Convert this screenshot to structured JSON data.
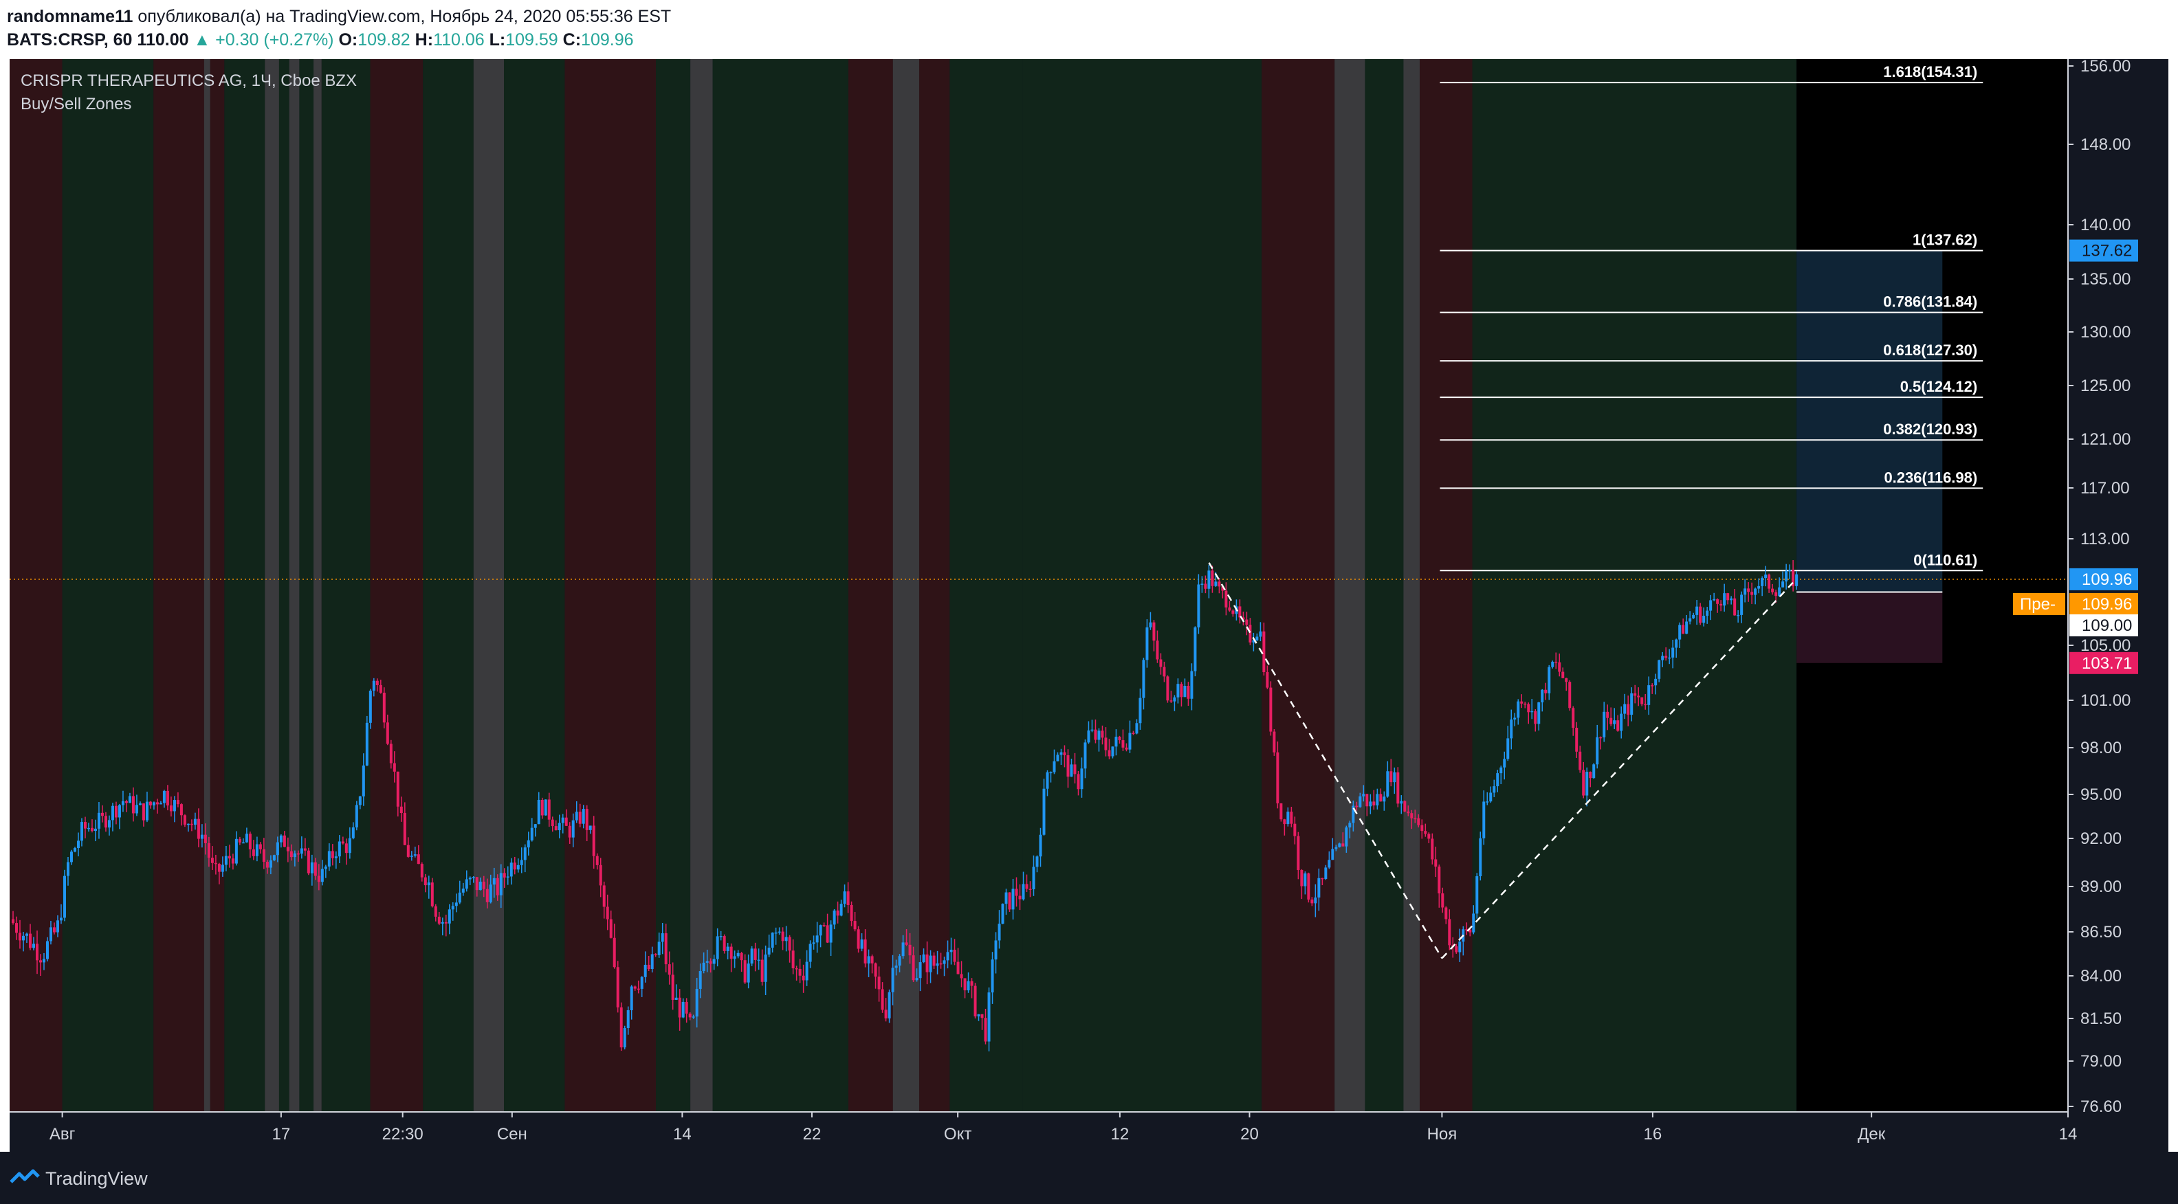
{
  "header": {
    "author": "randomname11",
    "published_text": "опубликовал(а) на TradingView.com, Ноябрь 24, 2020 05:55:36 EST",
    "symbol": "BATS:CRSP, 60",
    "last": "110.00",
    "change": "+0.30 (+0.27%)",
    "o_label": "O:",
    "o_value": "109.82",
    "h_label": "H:",
    "h_value": "110.06",
    "l_label": "L:",
    "l_value": "109.59",
    "c_label": "C:",
    "c_value": "109.96"
  },
  "legend": {
    "title": "CRISPR THERAPEUTICS AG, 1Ч, Cboe BZX",
    "indicator": "Buy/Sell Zones"
  },
  "footer": {
    "brand": "TradingView"
  },
  "colors": {
    "background": "#131722",
    "up": "#2196f3",
    "down": "#e91e63",
    "zone_buy": "#11251a",
    "zone_sell": "#2f1317",
    "zone_neutral": "#3a3a3d",
    "axis_text": "#d1d4dc",
    "price_line": "#ff9800"
  },
  "chart_data": {
    "type": "candlestick",
    "title": "CRISPR THERAPEUTICS AG, 1Ч, Cboe BZX",
    "xlabel": "",
    "ylabel": "",
    "ylim": [
      76.6,
      156.0
    ],
    "y_ticks": [
      "156.00",
      "148.00",
      "140.00",
      "135.00",
      "130.00",
      "125.00",
      "121.00",
      "117.00",
      "113.00",
      "105.00",
      "101.00",
      "98.00",
      "95.00",
      "92.00",
      "89.00",
      "86.50",
      "84.00",
      "81.50",
      "79.00",
      "76.60"
    ],
    "x_ticks": [
      {
        "label": "Авг",
        "pos": 0.0
      },
      {
        "label": "17",
        "pos": 10.8
      },
      {
        "label": "22:30",
        "pos": 16.8
      },
      {
        "label": "Сен",
        "pos": 22.2
      },
      {
        "label": "14",
        "pos": 30.6
      },
      {
        "label": "22",
        "pos": 37.0
      },
      {
        "label": "Окт",
        "pos": 44.2
      },
      {
        "label": "12",
        "pos": 52.2
      },
      {
        "label": "20",
        "pos": 58.6
      },
      {
        "label": "Ноя",
        "pos": 68.1
      },
      {
        "label": "16",
        "pos": 78.5
      },
      {
        "label": "Дек",
        "pos": 89.3
      },
      {
        "label": "14",
        "pos": 99.0
      }
    ],
    "x_range": [
      -2.6,
      99.0
    ],
    "price_path": [
      [
        -2.6,
        87.2
      ],
      [
        -2.0,
        86.5
      ],
      [
        -1.0,
        85.2
      ],
      [
        -0.2,
        86.8
      ],
      [
        0.3,
        90.5
      ],
      [
        1.0,
        92.6
      ],
      [
        2.0,
        93.2
      ],
      [
        3.0,
        94.6
      ],
      [
        4.0,
        93.8
      ],
      [
        5.0,
        95.1
      ],
      [
        6.0,
        93.6
      ],
      [
        7.0,
        92.1
      ],
      [
        7.5,
        89.6
      ],
      [
        8.3,
        90.9
      ],
      [
        9.0,
        91.8
      ],
      [
        10.0,
        90.6
      ],
      [
        11.0,
        91.9
      ],
      [
        12.0,
        90.6
      ],
      [
        12.8,
        89.6
      ],
      [
        13.5,
        91.4
      ],
      [
        14.3,
        91.7
      ],
      [
        14.8,
        96.1
      ],
      [
        15.3,
        103.0
      ],
      [
        15.8,
        101.0
      ],
      [
        16.4,
        96.2
      ],
      [
        16.9,
        91.5
      ],
      [
        17.4,
        90.4
      ],
      [
        18.0,
        89.6
      ],
      [
        18.4,
        87.9
      ],
      [
        18.9,
        86.9
      ],
      [
        19.5,
        88.6
      ],
      [
        20.2,
        89.3
      ],
      [
        20.9,
        88.8
      ],
      [
        21.5,
        88.9
      ],
      [
        22.0,
        90.1
      ],
      [
        22.5,
        90.9
      ],
      [
        23.0,
        92.2
      ],
      [
        23.6,
        94.4
      ],
      [
        24.3,
        93.2
      ],
      [
        25.0,
        92.5
      ],
      [
        25.7,
        93.7
      ],
      [
        26.1,
        92.1
      ],
      [
        26.6,
        88.6
      ],
      [
        27.1,
        85.8
      ],
      [
        27.6,
        80.2
      ],
      [
        28.1,
        83.6
      ],
      [
        28.6,
        83.9
      ],
      [
        29.1,
        84.6
      ],
      [
        29.6,
        86.2
      ],
      [
        30.1,
        82.8
      ],
      [
        30.6,
        81.9
      ],
      [
        31.1,
        80.7
      ],
      [
        31.6,
        85.3
      ],
      [
        32.1,
        85.4
      ],
      [
        32.6,
        86.0
      ],
      [
        33.1,
        85.6
      ],
      [
        33.6,
        84.0
      ],
      [
        34.1,
        85.1
      ],
      [
        34.6,
        84.1
      ],
      [
        35.1,
        86.3
      ],
      [
        35.6,
        86.5
      ],
      [
        36.1,
        84.3
      ],
      [
        36.6,
        84.3
      ],
      [
        37.1,
        86.4
      ],
      [
        37.6,
        86.2
      ],
      [
        38.1,
        87.3
      ],
      [
        38.6,
        88.4
      ],
      [
        39.1,
        87.1
      ],
      [
        39.6,
        84.8
      ],
      [
        40.1,
        83.9
      ],
      [
        40.6,
        81.7
      ],
      [
        41.1,
        85.2
      ],
      [
        41.6,
        85.8
      ],
      [
        42.1,
        84.1
      ],
      [
        42.6,
        84.8
      ],
      [
        43.1,
        84.6
      ],
      [
        43.6,
        85.7
      ],
      [
        44.1,
        84.2
      ],
      [
        44.6,
        83.7
      ],
      [
        45.1,
        82.1
      ],
      [
        45.6,
        80.7
      ],
      [
        46.1,
        86.6
      ],
      [
        46.6,
        88.1
      ],
      [
        47.1,
        88.7
      ],
      [
        47.6,
        88.5
      ],
      [
        48.1,
        90.9
      ],
      [
        48.6,
        96.4
      ],
      [
        49.1,
        97.9
      ],
      [
        49.6,
        96.8
      ],
      [
        50.1,
        95.5
      ],
      [
        50.6,
        98.9
      ],
      [
        51.1,
        98.6
      ],
      [
        51.6,
        97.9
      ],
      [
        52.1,
        98.3
      ],
      [
        52.6,
        98.6
      ],
      [
        53.1,
        100.2
      ],
      [
        53.6,
        107.0
      ],
      [
        54.1,
        103.7
      ],
      [
        54.6,
        101.4
      ],
      [
        55.1,
        102.0
      ],
      [
        55.6,
        101.1
      ],
      [
        56.1,
        109.4
      ],
      [
        56.6,
        110.2
      ],
      [
        57.1,
        109.0
      ],
      [
        57.6,
        108.3
      ],
      [
        58.1,
        106.8
      ],
      [
        58.6,
        105.6
      ],
      [
        59.1,
        106.4
      ],
      [
        59.6,
        100.0
      ],
      [
        60.1,
        93.4
      ],
      [
        60.6,
        93.9
      ],
      [
        61.1,
        89.8
      ],
      [
        61.6,
        88.5
      ],
      [
        62.1,
        88.9
      ],
      [
        62.6,
        90.5
      ],
      [
        63.1,
        91.4
      ],
      [
        63.6,
        93.6
      ],
      [
        64.1,
        95.0
      ],
      [
        64.6,
        94.2
      ],
      [
        65.1,
        95.1
      ],
      [
        65.6,
        96.5
      ],
      [
        66.1,
        94.3
      ],
      [
        66.6,
        93.7
      ],
      [
        67.1,
        93.1
      ],
      [
        67.6,
        90.9
      ],
      [
        68.1,
        88.0
      ],
      [
        68.6,
        85.6
      ],
      [
        69.1,
        86.2
      ],
      [
        69.6,
        86.7
      ],
      [
        70.1,
        93.6
      ],
      [
        70.6,
        95.3
      ],
      [
        71.1,
        97.4
      ],
      [
        71.6,
        99.9
      ],
      [
        72.1,
        101.6
      ],
      [
        72.6,
        99.8
      ],
      [
        73.1,
        101.5
      ],
      [
        73.6,
        103.8
      ],
      [
        74.1,
        102.6
      ],
      [
        74.6,
        99.1
      ],
      [
        75.1,
        95.5
      ],
      [
        75.6,
        97.3
      ],
      [
        76.1,
        100.3
      ],
      [
        76.6,
        99.1
      ],
      [
        77.1,
        100.2
      ],
      [
        77.6,
        101.3
      ],
      [
        78.1,
        101.0
      ],
      [
        78.6,
        103.1
      ],
      [
        79.1,
        104.1
      ],
      [
        79.6,
        105.3
      ],
      [
        80.1,
        106.6
      ],
      [
        80.6,
        107.5
      ],
      [
        81.1,
        107.2
      ],
      [
        81.6,
        108.7
      ],
      [
        82.1,
        108.6
      ],
      [
        82.6,
        107.2
      ],
      [
        83.1,
        108.9
      ],
      [
        83.6,
        109.6
      ],
      [
        84.1,
        109.7
      ],
      [
        84.6,
        109.3
      ],
      [
        85.1,
        110.0
      ],
      [
        85.6,
        109.96
      ]
    ],
    "zones": [
      {
        "from": -2.6,
        "to": 0.0,
        "kind": "sell"
      },
      {
        "from": 0.0,
        "to": 4.5,
        "kind": "buy"
      },
      {
        "from": 4.5,
        "to": 7.0,
        "kind": "sell"
      },
      {
        "from": 7.0,
        "to": 7.3,
        "kind": "neutral"
      },
      {
        "from": 7.3,
        "to": 8.0,
        "kind": "sell"
      },
      {
        "from": 8.0,
        "to": 10.0,
        "kind": "buy"
      },
      {
        "from": 10.0,
        "to": 10.7,
        "kind": "neutral"
      },
      {
        "from": 10.7,
        "to": 11.2,
        "kind": "buy"
      },
      {
        "from": 11.2,
        "to": 11.7,
        "kind": "neutral"
      },
      {
        "from": 11.7,
        "to": 12.4,
        "kind": "buy"
      },
      {
        "from": 12.4,
        "to": 12.8,
        "kind": "neutral"
      },
      {
        "from": 12.8,
        "to": 15.2,
        "kind": "buy"
      },
      {
        "from": 15.2,
        "to": 17.8,
        "kind": "sell"
      },
      {
        "from": 17.8,
        "to": 20.3,
        "kind": "buy"
      },
      {
        "from": 20.3,
        "to": 21.8,
        "kind": "neutral"
      },
      {
        "from": 21.8,
        "to": 24.8,
        "kind": "buy"
      },
      {
        "from": 24.8,
        "to": 29.3,
        "kind": "sell"
      },
      {
        "from": 29.3,
        "to": 31.0,
        "kind": "buy"
      },
      {
        "from": 31.0,
        "to": 32.1,
        "kind": "neutral"
      },
      {
        "from": 32.1,
        "to": 38.8,
        "kind": "buy"
      },
      {
        "from": 38.8,
        "to": 41.0,
        "kind": "sell"
      },
      {
        "from": 41.0,
        "to": 42.3,
        "kind": "neutral"
      },
      {
        "from": 42.3,
        "to": 43.8,
        "kind": "sell"
      },
      {
        "from": 43.8,
        "to": 47.4,
        "kind": "buy"
      },
      {
        "from": 47.4,
        "to": 59.2,
        "kind": "buy"
      },
      {
        "from": 59.2,
        "to": 62.8,
        "kind": "sell"
      },
      {
        "from": 62.8,
        "to": 64.3,
        "kind": "neutral"
      },
      {
        "from": 64.3,
        "to": 66.2,
        "kind": "buy"
      },
      {
        "from": 66.2,
        "to": 67.0,
        "kind": "neutral"
      },
      {
        "from": 67.0,
        "to": 69.6,
        "kind": "sell"
      },
      {
        "from": 69.6,
        "to": 85.6,
        "kind": "buy"
      }
    ],
    "fibonacci": [
      {
        "label": "1.618(154.31)",
        "value": 154.31
      },
      {
        "label": "1(137.62)",
        "value": 137.62
      },
      {
        "label": "0.786(131.84)",
        "value": 131.84
      },
      {
        "label": "0.618(127.30)",
        "value": 127.3
      },
      {
        "label": "0.5(124.12)",
        "value": 124.12
      },
      {
        "label": "0.382(120.93)",
        "value": 120.93
      },
      {
        "label": "0.236(116.98)",
        "value": 116.98
      },
      {
        "label": "0(110.61)",
        "value": 110.61
      }
    ],
    "fib_x_from": 68.0,
    "fib_x_to": 94.8,
    "trend_lines": [
      {
        "x1": 56.6,
        "y1": 111.2,
        "x2": 68.1,
        "y2": 85.0
      },
      {
        "x1": 68.1,
        "y1": 85.0,
        "x2": 85.6,
        "y2": 110.0
      }
    ],
    "position_tool": {
      "x_from": 85.6,
      "x_to": 92.8,
      "entry": 109.0,
      "target": 137.62,
      "stop": 103.71
    },
    "price_labels": [
      {
        "text": "137.62",
        "value": 137.62,
        "color": "#2196f3",
        "text_color": "#131722"
      },
      {
        "text": "109.96",
        "value": 109.96,
        "color": "#2196f3",
        "text_color": "#ffffff"
      },
      {
        "text": "109.96",
        "value": 108.1,
        "color": "#ff9800",
        "text_color": "#ffffff",
        "tag": "Пре-"
      },
      {
        "text": "109.00",
        "value": 106.5,
        "color": "#ffffff",
        "text_color": "#131722"
      },
      {
        "text": "103.71",
        "value": 103.71,
        "color": "#e91e63",
        "text_color": "#ffffff"
      }
    ],
    "last_price": 109.96
  }
}
